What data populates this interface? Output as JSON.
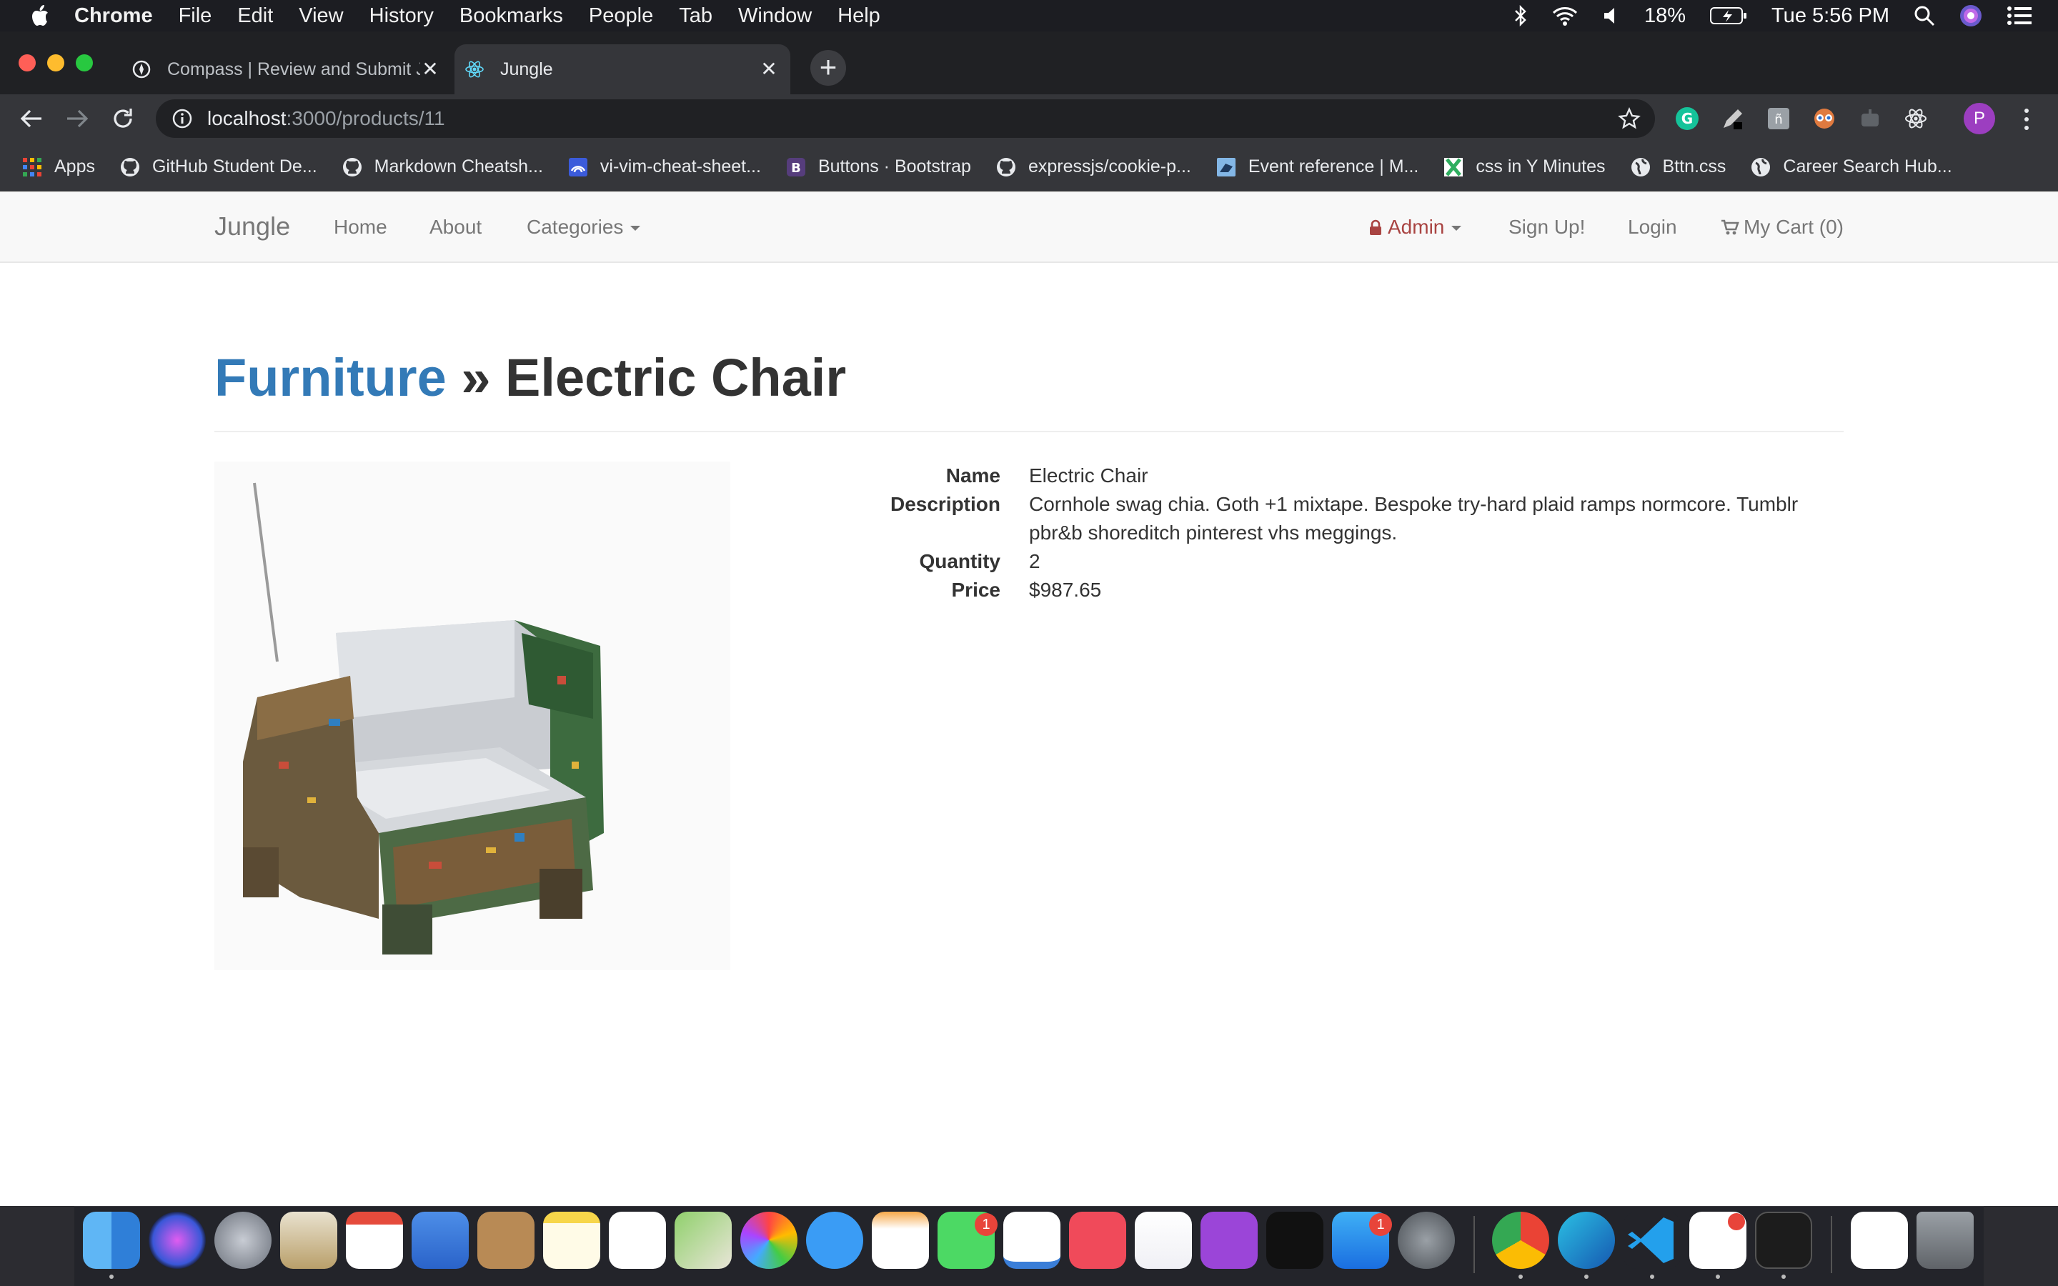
{
  "menubar": {
    "app": "Chrome",
    "items": [
      "File",
      "Edit",
      "View",
      "History",
      "Bookmarks",
      "People",
      "Tab",
      "Window",
      "Help"
    ],
    "battery": "18%",
    "clock": "Tue 5:56 PM"
  },
  "tabs": [
    {
      "title": "Compass | Review and Submit J",
      "active": false
    },
    {
      "title": "Jungle",
      "active": true
    }
  ],
  "url": {
    "host": "localhost",
    "path": ":3000/products/11"
  },
  "bookmarks": [
    {
      "label": "Apps",
      "icon": "apps-grid-icon"
    },
    {
      "label": "GitHub Student De...",
      "icon": "github-icon"
    },
    {
      "label": "Markdown Cheatsh...",
      "icon": "github-icon"
    },
    {
      "label": "vi-vim-cheat-sheet...",
      "icon": "vim-icon"
    },
    {
      "label": "Buttons · Bootstrap",
      "icon": "bootstrap-icon"
    },
    {
      "label": "expressjs/cookie-p...",
      "icon": "github-icon"
    },
    {
      "label": "Event reference | M...",
      "icon": "mdn-icon"
    },
    {
      "label": "css in Y Minutes",
      "icon": "xminutes-icon"
    },
    {
      "label": "Bttn.css",
      "icon": "globe-icon"
    },
    {
      "label": "Career Search Hub...",
      "icon": "globe-icon"
    }
  ],
  "navbar": {
    "brand": "Jungle",
    "home": "Home",
    "about": "About",
    "categories": "Categories",
    "admin": "Admin",
    "signup": "Sign Up!",
    "login": "Login",
    "cart": "My Cart (0)"
  },
  "product": {
    "category": "Furniture",
    "separator": " » ",
    "title": "Electric Chair",
    "labels": {
      "name": "Name",
      "description": "Description",
      "quantity": "Quantity",
      "price": "Price"
    },
    "name": "Electric Chair",
    "description": "Cornhole swag chia. Goth +1 mixtape. Bespoke try-hard plaid ramps normcore. Tumblr pbr&b shoreditch pinterest vhs meggings.",
    "quantity": "2",
    "price": "$987.65"
  },
  "dock": {
    "badges": {
      "facetime": "1",
      "appstore": "1"
    }
  },
  "colors": {
    "link": "#337ab7",
    "admin": "#a94442",
    "heading": "#333333"
  }
}
